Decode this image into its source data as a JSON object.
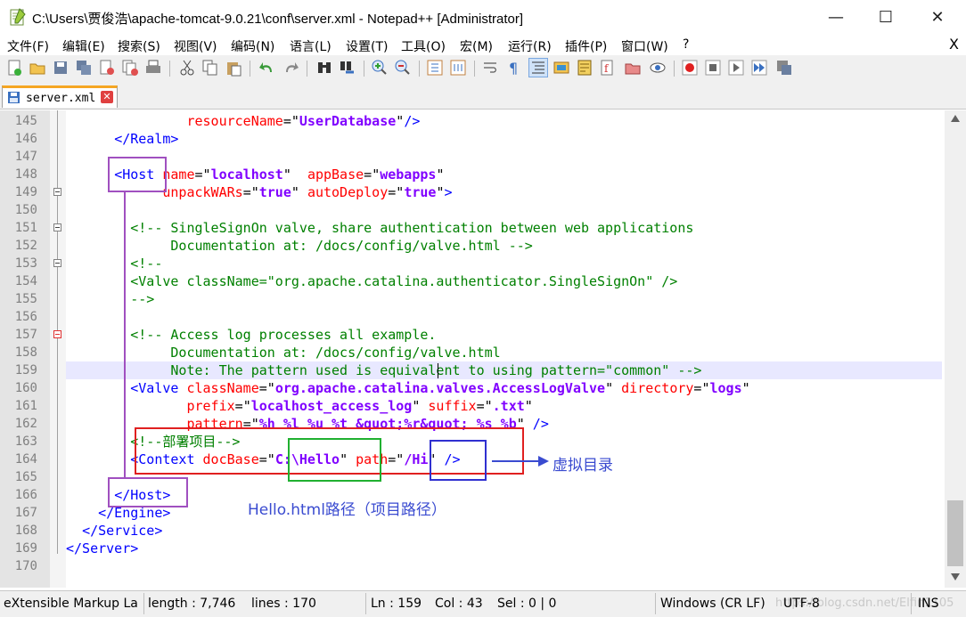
{
  "window": {
    "title": "C:\\Users\\贾俊浩\\apache-tomcat-9.0.21\\conf\\server.xml - Notepad++ [Administrator]",
    "minimize": "—",
    "maximize": "☐",
    "close": "✕"
  },
  "menu": {
    "items": [
      "文件(F)",
      "编辑(E)",
      "搜索(S)",
      "视图(V)",
      "编码(N)",
      "语言(L)",
      "设置(T)",
      "工具(O)",
      "宏(M)",
      "运行(R)",
      "插件(P)",
      "窗口(W)",
      "?"
    ],
    "close": "X"
  },
  "tabs": [
    {
      "label": "server.xml",
      "close": "✕"
    }
  ],
  "editor": {
    "line_numbers": [
      "145",
      "146",
      "147",
      "148",
      "149",
      "150",
      "151",
      "152",
      "153",
      "154",
      "155",
      "156",
      "157",
      "158",
      "159",
      "160",
      "161",
      "162",
      "163",
      "164",
      "165",
      "166",
      "167",
      "168",
      "169",
      "170"
    ],
    "current_line": "159"
  },
  "annotations": {
    "virtual_dir": "虚拟目录",
    "hello_path": "Hello.html路径（项目路径）",
    "box_colors": {
      "host": "#a050c0",
      "context": "#e02020",
      "docbase": "#20b030",
      "path": "#3030d0",
      "arrow": "#3a4bd0"
    }
  },
  "status": {
    "language": "eXtensible Markup La",
    "length": "length : 7,746",
    "lines": "lines : 170",
    "ln": "Ln : 159",
    "col": "Col : 43",
    "sel": "Sel : 0 | 0",
    "eol": "Windows (CR LF)",
    "encoding": "UTF-8",
    "mode": "INS",
    "watermark": "https://blog.csdn.net/Elfin1105"
  }
}
